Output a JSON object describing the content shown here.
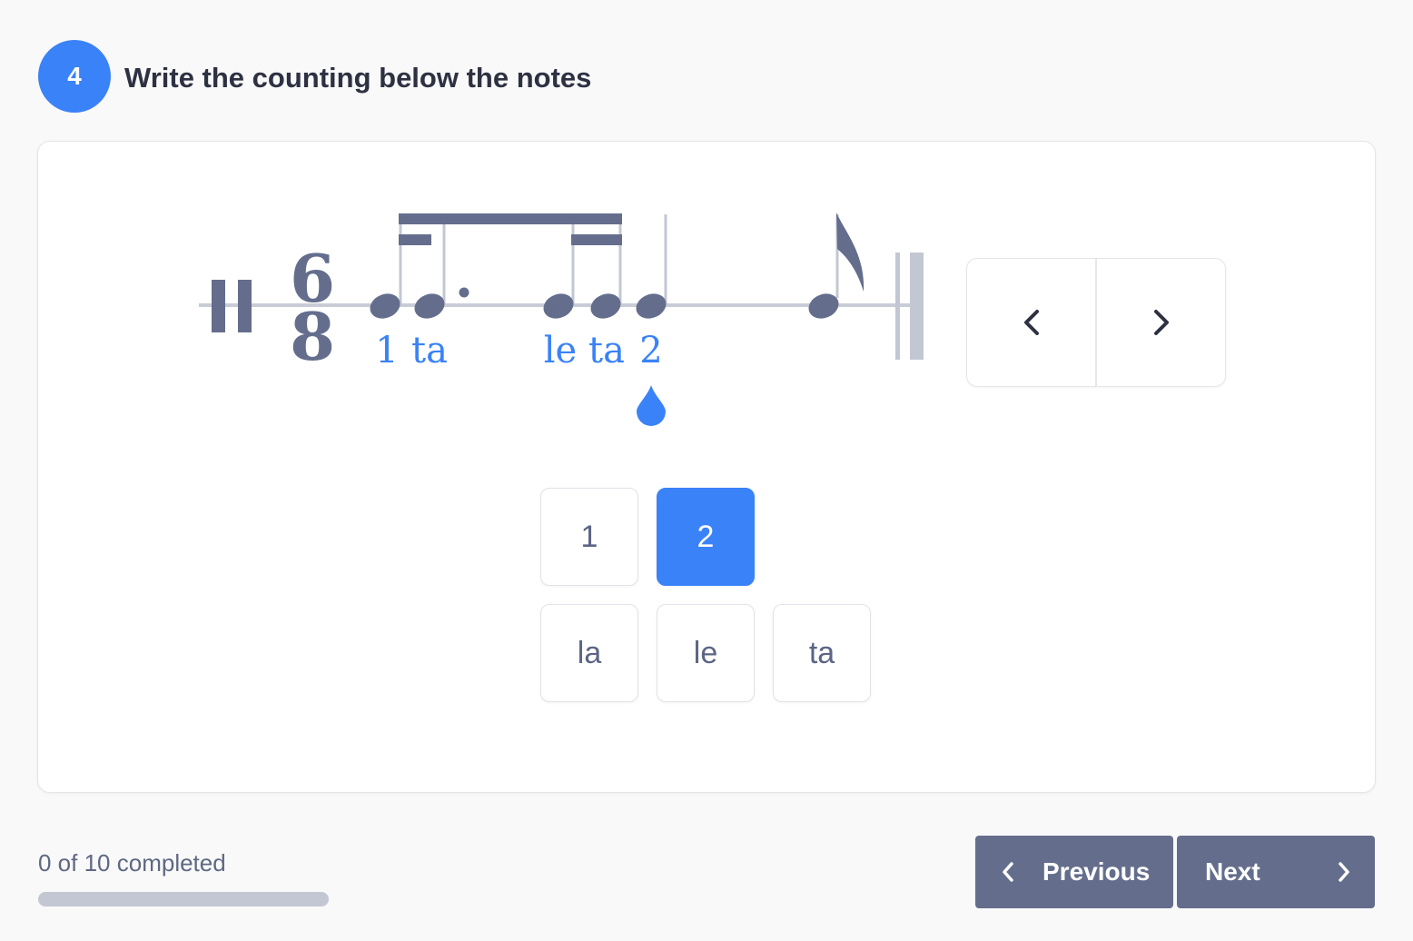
{
  "question": {
    "number": "4",
    "title": "Write the counting below the notes"
  },
  "notation": {
    "time_signature": {
      "top": "6",
      "bottom": "8"
    },
    "count_labels": [
      "1",
      "ta",
      "le",
      "ta",
      "2"
    ],
    "cursor_icon": "drop-icon"
  },
  "nav": {
    "prev_icon": "chevron-left-icon",
    "next_icon": "chevron-right-icon"
  },
  "choices": [
    {
      "label": "1",
      "selected": false
    },
    {
      "label": "2",
      "selected": true
    },
    {
      "label": "la",
      "selected": false
    },
    {
      "label": "le",
      "selected": false
    },
    {
      "label": "ta",
      "selected": false
    }
  ],
  "progress": {
    "text": "0 of 10 completed",
    "completed": 0,
    "total": 10
  },
  "footer": {
    "previous_label": "Previous",
    "next_label": "Next"
  },
  "colors": {
    "accent": "#3a82f7",
    "notation": "#646e8c",
    "button": "#646e8c"
  }
}
